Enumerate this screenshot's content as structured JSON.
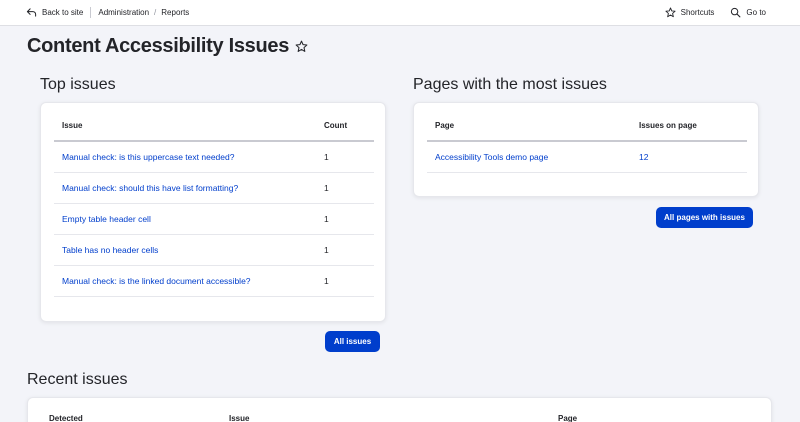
{
  "toolbar": {
    "back_label": "Back to site",
    "breadcrumb": [
      "Administration",
      "Reports"
    ],
    "shortcuts_label": "Shortcuts",
    "goto_label": "Go to"
  },
  "page": {
    "title": "Content Accessibility Issues"
  },
  "top_issues": {
    "title": "Top issues",
    "headers": [
      "Issue",
      "Count"
    ],
    "rows": [
      {
        "issue": "Manual check: is this uppercase text needed?",
        "count": "1"
      },
      {
        "issue": "Manual check: should this have list formatting?",
        "count": "1"
      },
      {
        "issue": "Empty table header cell",
        "count": "1"
      },
      {
        "issue": "Table has no header cells",
        "count": "1"
      },
      {
        "issue": "Manual check: is the linked document accessible?",
        "count": "1"
      }
    ],
    "button_label": "All issues"
  },
  "pages_issues": {
    "title": "Pages with the most issues",
    "headers": [
      "Page",
      "Issues on page"
    ],
    "rows": [
      {
        "page": "Accessibility Tools demo page",
        "issues": "12"
      }
    ],
    "button_label": "All pages with issues"
  },
  "recent_issues": {
    "title": "Recent issues",
    "headers": [
      "Detected",
      "Issue",
      "Page"
    ]
  },
  "colors": {
    "accent": "#003ecc",
    "background": "#f3f4f9"
  }
}
